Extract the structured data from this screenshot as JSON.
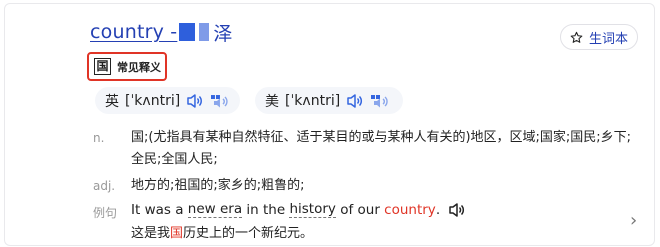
{
  "entry": {
    "title": "country - ",
    "title_tail": "泽",
    "add_vocab_label": "生词本",
    "badge_char": "国",
    "badge_label": "常见释义"
  },
  "pronunciations": [
    {
      "region": "英",
      "ipa": "[ˈkʌntri]"
    },
    {
      "region": "美",
      "ipa": "[ˈkʌntri]"
    }
  ],
  "definitions": [
    {
      "pos": "n.",
      "text": "国;(尤指具有某种自然特征、适于某目的或与某种人有关的)地区，区域;国家;国民;乡下;全民;全国人民;"
    },
    {
      "pos": "adj.",
      "text": "地方的;祖国的;家乡的;粗鲁的;"
    }
  ],
  "example": {
    "label": "例句",
    "en_before": "It was a",
    "en_new_era": "new era",
    "en_mid": "in the",
    "en_history": "history",
    "en_of": "of our",
    "en_highlight": "country",
    "en_end": ".",
    "cn_before": "这是我",
    "cn_highlight": "国",
    "cn_after": "历史上的一个新纪元。"
  },
  "colors": {
    "link": "#2440b3",
    "highlight": "#e03426",
    "pron_bg": "#f4f6fa"
  }
}
